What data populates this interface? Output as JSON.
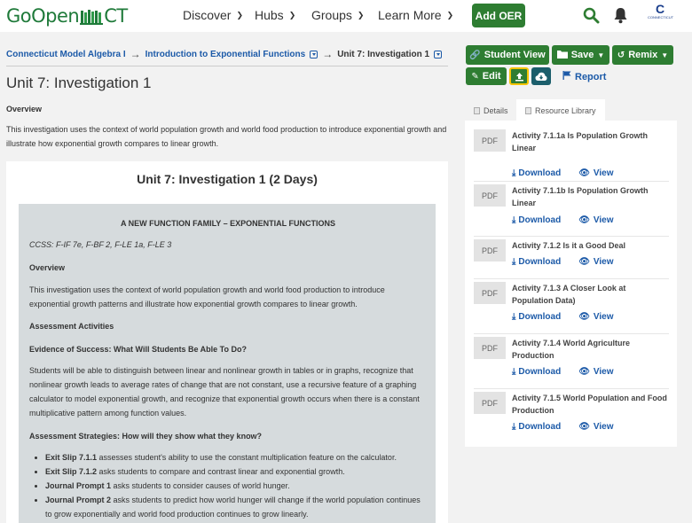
{
  "header": {
    "logo_left": "GoOpen",
    "logo_right": "CT",
    "nav": [
      {
        "label": "Discover"
      },
      {
        "label": "Hubs"
      },
      {
        "label": "Groups"
      },
      {
        "label": "Learn More"
      }
    ],
    "add_oer": "Add OER",
    "org_logo_letter": "C",
    "org_logo_text": "CONNECTICUT"
  },
  "breadcrumb": {
    "items": [
      "Connecticut Model Algebra I",
      "Introduction to Exponential Functions",
      "Unit 7: Investigation 1"
    ],
    "separator": "→"
  },
  "page": {
    "title": "Unit 7: Investigation 1",
    "overview_label": "Overview",
    "overview_text": "This investigation uses the context of world population growth and world food production to introduce exponential growth and illustrate how exponential growth compares to linear growth."
  },
  "content": {
    "title": "Unit 7: Investigation 1 (2 Days)",
    "heading": "A NEW FUNCTION FAMILY – EXPONENTIAL FUNCTIONS",
    "ccss": "CCSS:   F-IF 7e, F-BF 2, F-LE 1a, F-LE 3",
    "overview_label": "Overview",
    "overview_text": "This investigation uses the context of world population growth and world food production to introduce exponential growth patterns and illustrate how exponential growth compares to linear growth.",
    "assessment_label": "Assessment Activities",
    "evidence_label": "Evidence of Success:  What Will Students Be Able To Do?",
    "evidence_text": "Students will be able to distinguish between linear and nonlinear growth in tables or in graphs, recognize that nonlinear growth leads to average rates of change that are not constant, use a recursive feature of a graphing calculator to model exponential growth, and recognize that exponential growth occurs when there is a constant multiplicative pattern among function values.",
    "strategies_label": "Assessment Strategies:  How will they show what they know?",
    "bullets": [
      {
        "bold": "Exit Slip 7.1.1",
        "text": " assesses student's ability to use the constant multiplication feature on the calculator."
      },
      {
        "bold": "Exit Slip 7.1.2",
        "text": " asks students to compare and contrast linear and exponential growth."
      },
      {
        "bold": "Journal Prompt 1",
        "text": " asks students to consider causes of world hunger."
      },
      {
        "bold": "Journal Prompt 2",
        "text": " asks students to predict how world hunger will change if the world population continues to grow exponentially and world food production continues to grow linearly."
      }
    ]
  },
  "actions": {
    "student_view": "Student View",
    "save": "Save",
    "remix": "Remix",
    "edit": "Edit",
    "report": "Report"
  },
  "tabs": [
    {
      "label": "Details",
      "active": false
    },
    {
      "label": "Resource Library",
      "active": true
    }
  ],
  "resources": [
    {
      "type": "PDF",
      "title": "Activity 7.1.1a Is Population Growth Linear",
      "download": "Download",
      "view": "View"
    },
    {
      "type": "PDF",
      "title": "Activity 7.1.1b Is Population Growth Linear",
      "download": "Download",
      "view": "View"
    },
    {
      "type": "PDF",
      "title": "Activity 7.1.2 Is it a Good Deal",
      "download": "Download",
      "view": "View"
    },
    {
      "type": "PDF",
      "title": "Activity 7.1.3 A Closer Look at Population Data)",
      "download": "Download",
      "view": "View"
    },
    {
      "type": "PDF",
      "title": "Activity 7.1.4 World Agriculture Production",
      "download": "Download",
      "view": "View"
    },
    {
      "type": "PDF",
      "title": "Activity 7.1.5 World Population and Food Production",
      "download": "Download",
      "view": "View"
    }
  ],
  "colors": {
    "brand_green": "#2e7d32",
    "link_blue": "#1c5aa8",
    "teal": "#1b5e6b",
    "highlight_yellow": "#f5c400"
  }
}
